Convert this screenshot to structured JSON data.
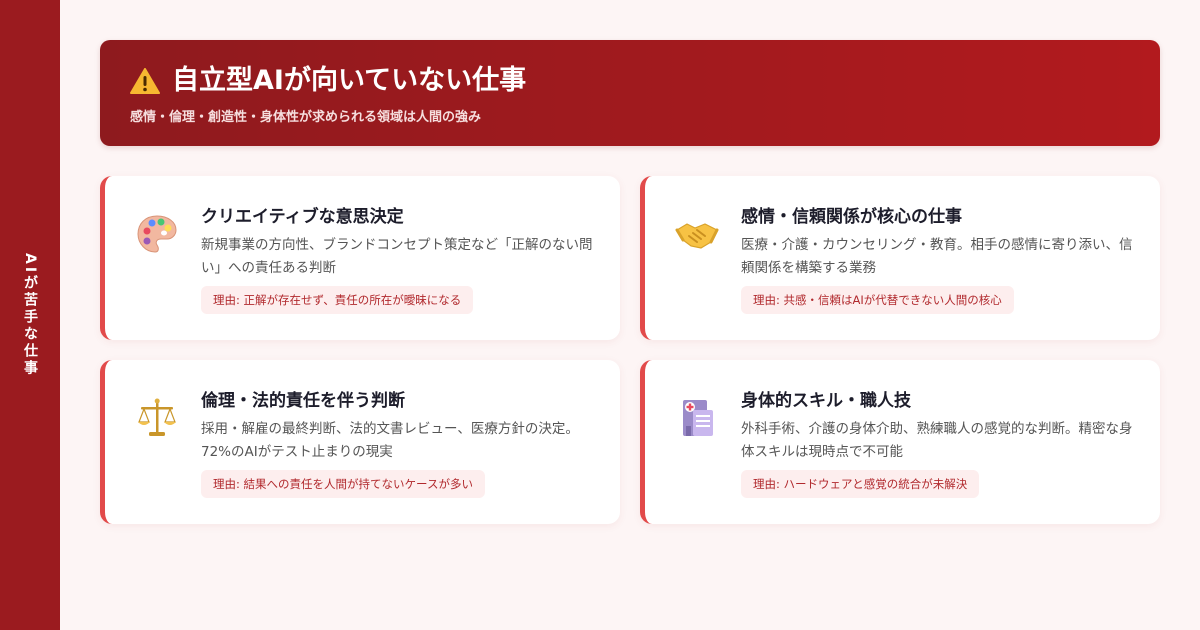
{
  "sidebar": {
    "label": "AIが苦手な仕事"
  },
  "banner": {
    "title": "自立型AIが向いていない仕事",
    "subtitle": "感情・倫理・創造性・身体性が求められる領域は人間の強み"
  },
  "cards": [
    {
      "icon": "palette-icon",
      "title": "クリエイティブな意思決定",
      "desc": "新規事業の方向性、ブランドコンセプト策定など「正解のない問い」への責任ある判断",
      "reason": "理由: 正解が存在せず、責任の所在が曖昧になる"
    },
    {
      "icon": "handshake-icon",
      "title": "感情・信頼関係が核心の仕事",
      "desc": "医療・介護・カウンセリング・教育。相手の感情に寄り添い、信頼関係を構築する業務",
      "reason": "理由: 共感・信頼はAIが代替できない人間の核心"
    },
    {
      "icon": "scales-icon",
      "title": "倫理・法的責任を伴う判断",
      "desc": "採用・解雇の最終判断、法的文書レビュー、医療方針の決定。72%のAIがテスト止まりの現実",
      "reason": "理由: 結果への責任を人間が持てないケースが多い"
    },
    {
      "icon": "hospital-icon",
      "title": "身体的スキル・職人技",
      "desc": "外科手術、介護の身体介助、熟練職人の感覚的な判断。精密な身体スキルは現時点で不可能",
      "reason": "理由: ハードウェアと感覚の統合が未解決"
    }
  ]
}
